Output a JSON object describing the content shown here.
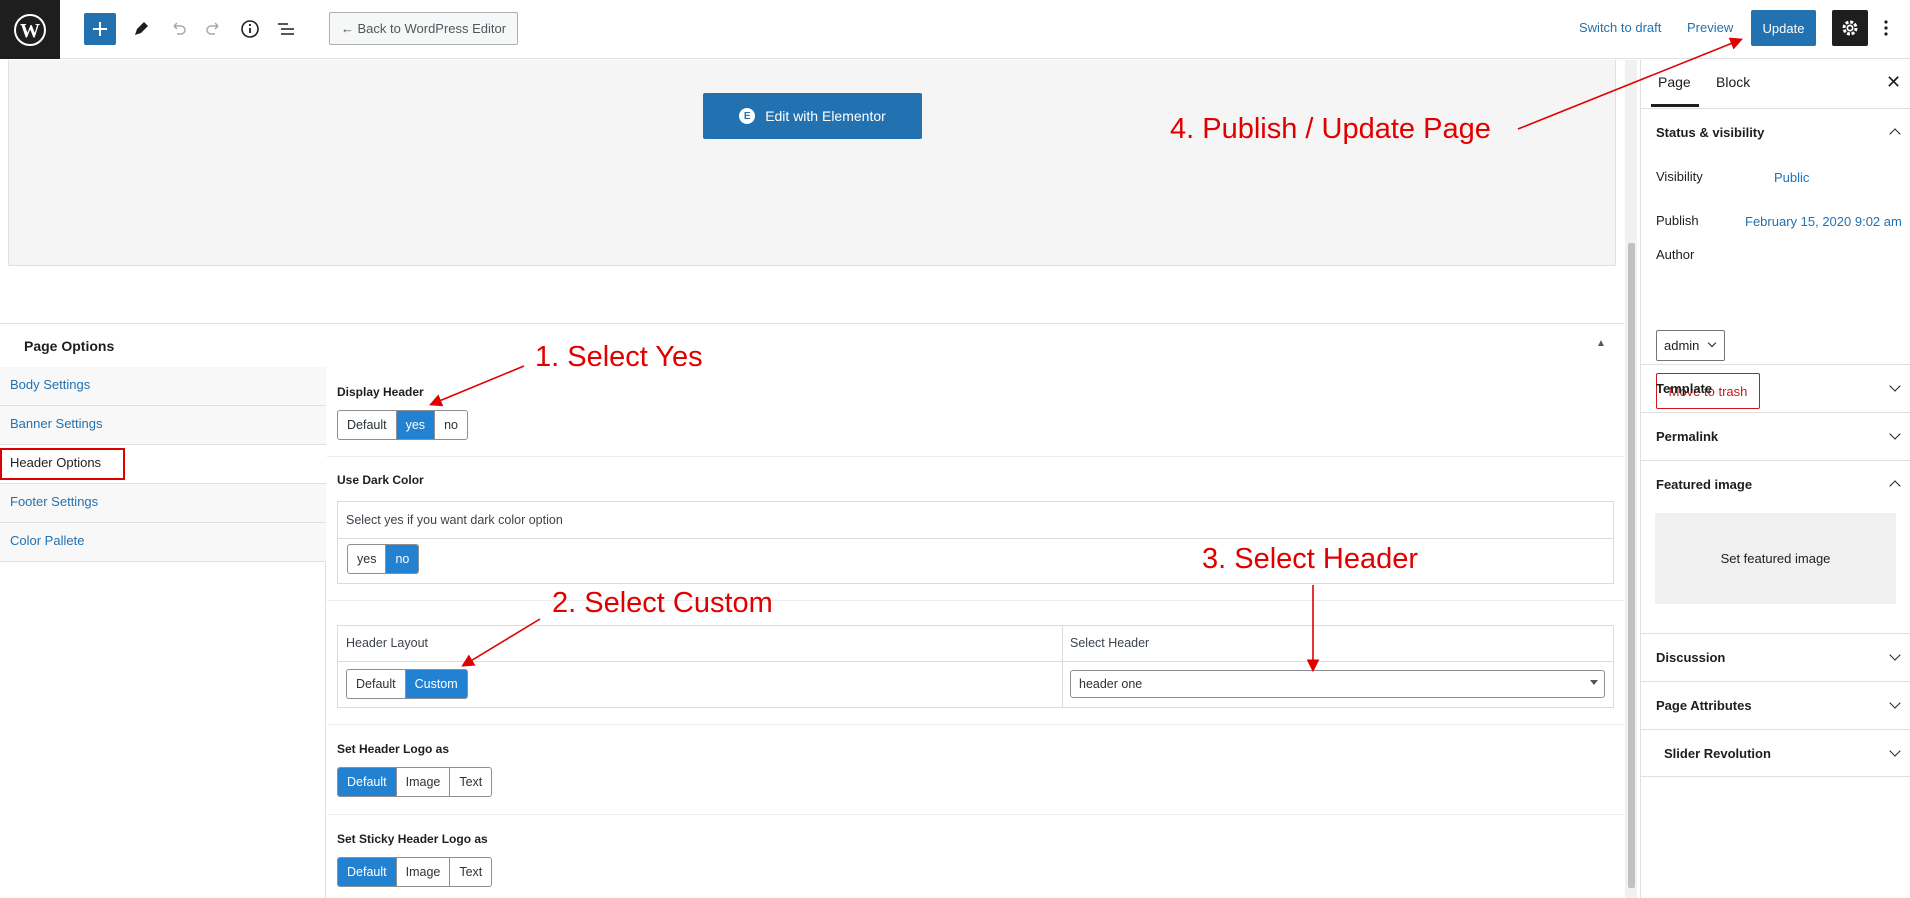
{
  "toolbar": {
    "back_label": "← Back to WordPress Editor",
    "switch_draft": "Switch to draft",
    "preview": "Preview",
    "update": "Update"
  },
  "editor": {
    "elementor_button": "Edit with Elementor"
  },
  "page_options": {
    "title": "Page Options",
    "nav": [
      {
        "label": "Body Settings"
      },
      {
        "label": "Banner Settings"
      },
      {
        "label": "Header Options",
        "active": true
      },
      {
        "label": "Footer Settings"
      },
      {
        "label": "Color Pallete"
      }
    ],
    "display_header": {
      "label": "Display Header",
      "options": [
        "Default",
        "yes",
        "no"
      ],
      "selected": "yes"
    },
    "dark_color": {
      "label": "Use Dark Color",
      "hint": "Select yes if you want dark color option",
      "options": [
        "yes",
        "no"
      ],
      "selected": "no"
    },
    "header_layout": {
      "label": "Header Layout",
      "options": [
        "Default",
        "Custom"
      ],
      "selected": "Custom"
    },
    "select_header": {
      "label": "Select Header",
      "value": "header one"
    },
    "header_logo": {
      "label": "Set Header Logo as",
      "options": [
        "Default",
        "Image",
        "Text"
      ],
      "selected": "Default"
    },
    "sticky_logo": {
      "label": "Set Sticky Header Logo as",
      "options": [
        "Default",
        "Image",
        "Text"
      ],
      "selected": "Default"
    }
  },
  "sidebar": {
    "tabs": [
      "Page",
      "Block"
    ],
    "status_title": "Status & visibility",
    "visibility_label": "Visibility",
    "visibility_value": "Public",
    "publish_label": "Publish",
    "publish_value": "February 15, 2020 9:02 am",
    "author_label": "Author",
    "author_value": "admin",
    "trash": "Move to trash",
    "panels": {
      "template": "Template",
      "permalink": "Permalink",
      "featured": "Featured image",
      "featured_btn": "Set featured image",
      "discussion": "Discussion",
      "attributes": "Page Attributes",
      "slider": "Slider Revolution"
    }
  },
  "annotations": {
    "step1": "1. Select Yes",
    "step2": "2. Select Custom",
    "step3": "3. Select Header",
    "step4": "4. Publish / Update Page"
  },
  "colors": {
    "accent": "#2271b1",
    "toggle_on": "#2281d1",
    "annotation": "#e00000",
    "dark": "#1e1e1e"
  },
  "icons": [
    "wordpress-logo-icon",
    "plus-icon",
    "pencil-icon",
    "undo-icon",
    "redo-icon",
    "info-icon",
    "list-view-icon",
    "gear-icon",
    "more-vertical-icon",
    "close-icon",
    "chevron-up-icon",
    "chevron-down-icon",
    "elementor-icon"
  ]
}
